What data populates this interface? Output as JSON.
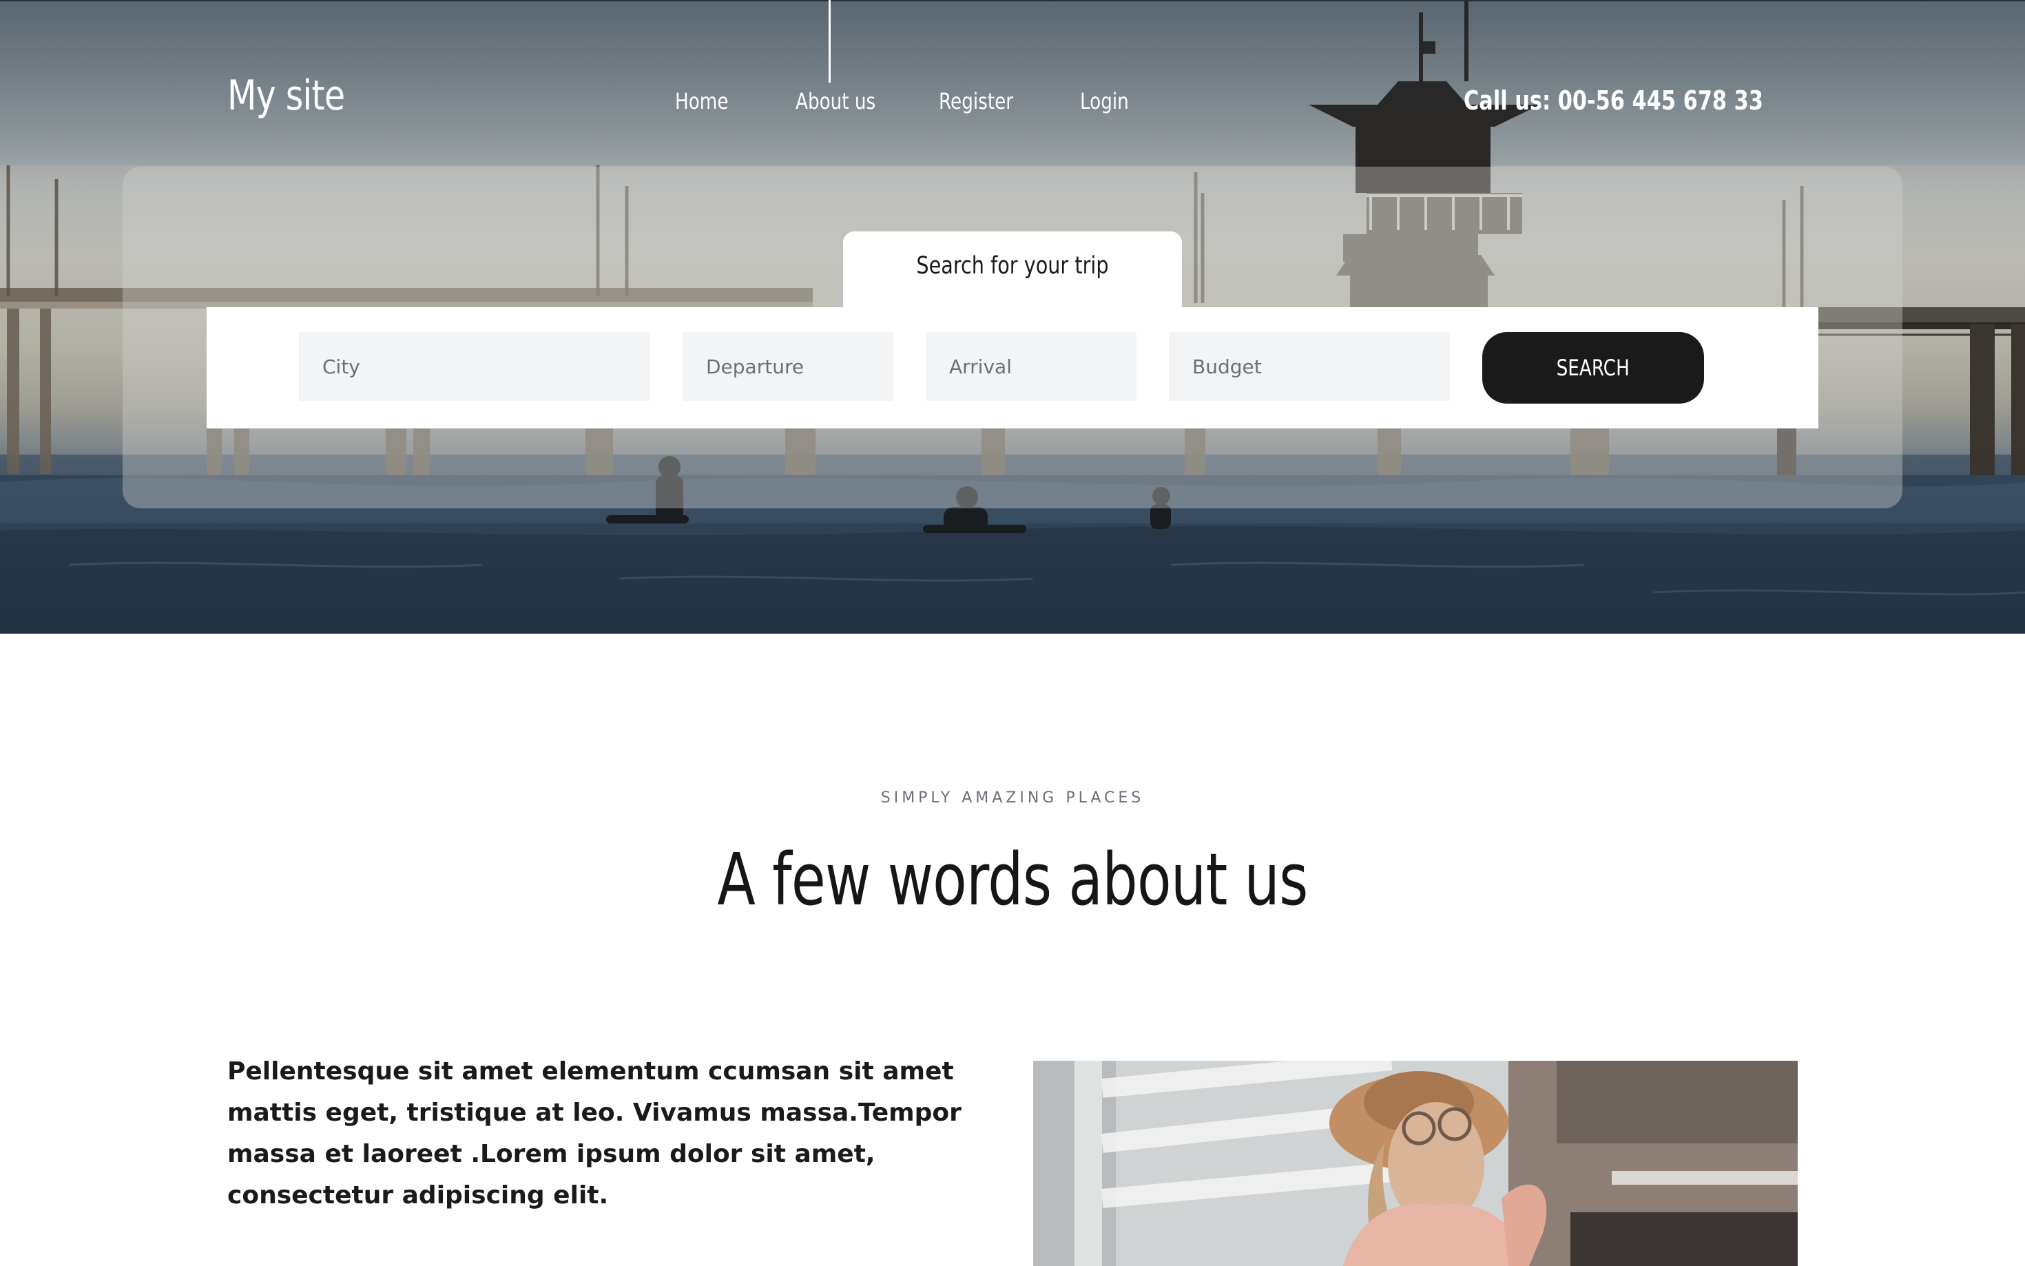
{
  "header": {
    "brand": "My site",
    "nav": [
      {
        "label": "Home"
      },
      {
        "label": "About us"
      },
      {
        "label": "Register"
      },
      {
        "label": "Login"
      }
    ],
    "active_nav": "About us",
    "phone": "Call us: 00-56 445 678 33"
  },
  "search": {
    "tab_label": "Search for your trip",
    "fields": {
      "city": {
        "placeholder": "City",
        "value": ""
      },
      "departure": {
        "placeholder": "Departure",
        "value": ""
      },
      "arrival": {
        "placeholder": "Arrival",
        "value": ""
      },
      "budget": {
        "placeholder": "Budget",
        "value": ""
      }
    },
    "button_label": "SEARCH"
  },
  "about": {
    "eyebrow": "SIMPLY AMAZING PLACES",
    "title": "A few words about us",
    "paragraph": "Pellentesque sit amet elementum ccumsan sit amet mattis eget, tristique at leo. Vivamus massa.Tempor massa et laoreet .Lorem ipsum dolor sit amet, consectetur adipiscing elit."
  },
  "colors": {
    "button_bg": "#1a1a1a",
    "field_bg": "#f3f4f6",
    "text_dark": "#161616",
    "muted": "#6b6f7a"
  }
}
